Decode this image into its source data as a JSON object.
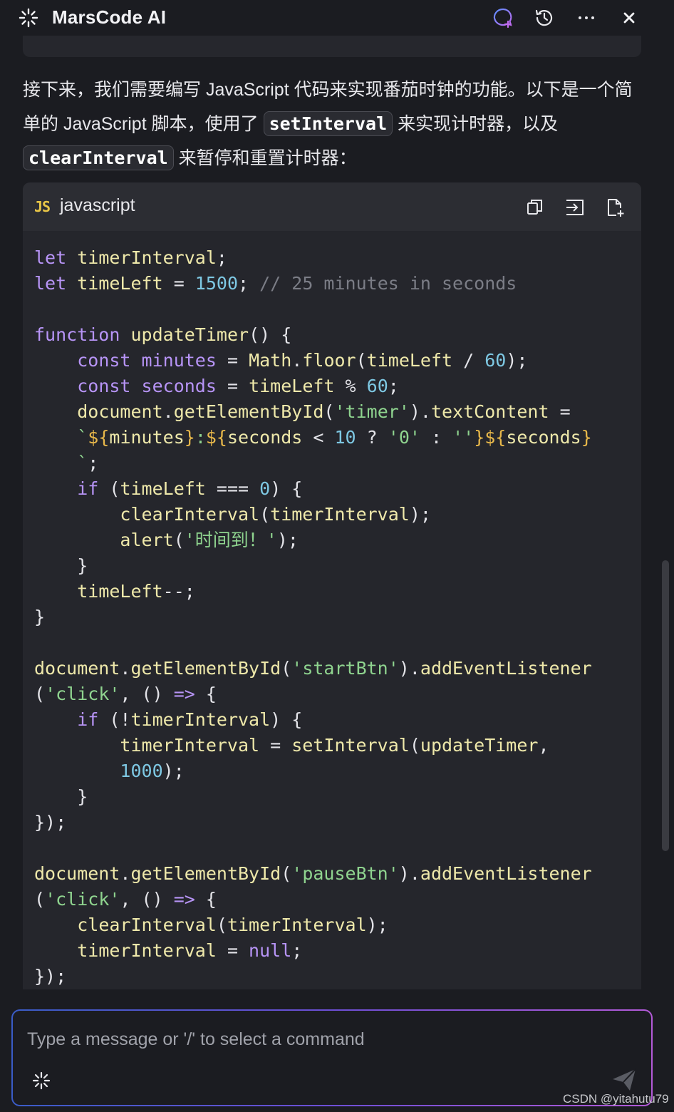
{
  "app": {
    "title": "MarsCode AI"
  },
  "header": {
    "new_chat_icon": "chat-plus-icon",
    "history_icon": "history-icon",
    "more_icon": "more-icon",
    "close_icon": "close-icon"
  },
  "message": {
    "para_part1": "接下来，我们需要编写 JavaScript 代码来实现番茄时钟的功能。以下是一个简单的 JavaScript 脚本，使用了 ",
    "inline_code_1": "setInterval",
    "para_part2": " 来实现计时器，以及 ",
    "inline_code_2": "clearInterval",
    "para_part3": " 来暂停和重置计时器："
  },
  "code_block": {
    "badge": "JS",
    "language": "javascript",
    "actions": [
      "copy-icon",
      "insert-icon",
      "new-file-icon"
    ]
  },
  "input": {
    "placeholder": "Type a message or '/' to select a command"
  },
  "watermark": "CSDN @yitahutu79",
  "colors": {
    "background": "#1b1c21",
    "code_bg": "#25262c",
    "keyword": "#b794f6",
    "variable": "#eee8aa",
    "number": "#7ec8e3",
    "string": "#8fd48f",
    "comment": "#7b7d86",
    "accent_gradient_start": "#3a5cc7",
    "accent_gradient_end": "#b35ad8"
  }
}
